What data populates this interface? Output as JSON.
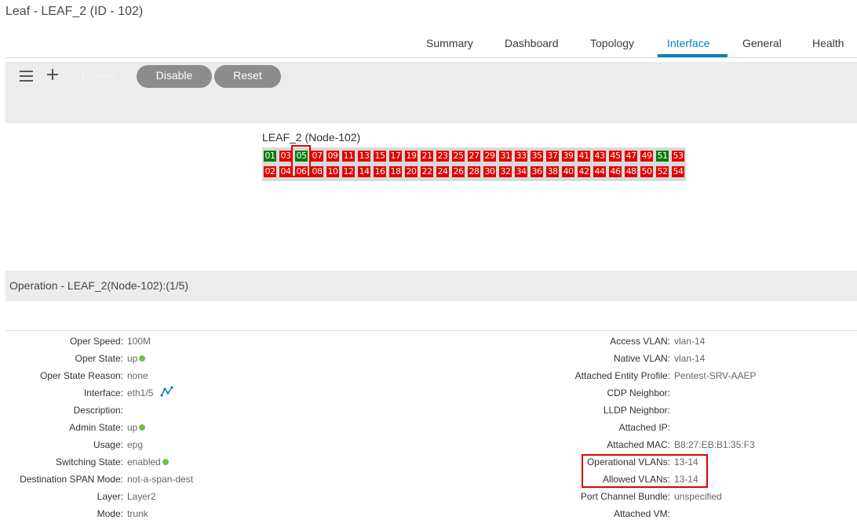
{
  "page_title": "Leaf - LEAF_2 (ID - 102)",
  "tabs": [
    {
      "label": "Summary"
    },
    {
      "label": "Dashboard"
    },
    {
      "label": "Topology"
    },
    {
      "label": "Interface",
      "active": true
    },
    {
      "label": "General"
    },
    {
      "label": "Health"
    }
  ],
  "toolbar": {
    "menu_icon": "hamburger-menu-icon",
    "add_icon": "plus-icon",
    "enable_label": "Enable",
    "disable_label": "Disable",
    "reset_label": "Reset"
  },
  "node": {
    "title": "LEAF_2 (Node-102)",
    "top_row": [
      {
        "id": "01",
        "state": "up"
      },
      {
        "id": "03",
        "state": "down"
      },
      {
        "id": "05",
        "state": "up"
      },
      {
        "id": "07",
        "state": "down"
      },
      {
        "id": "09",
        "state": "down"
      },
      {
        "id": "11",
        "state": "down"
      },
      {
        "id": "13",
        "state": "down"
      },
      {
        "id": "15",
        "state": "down"
      },
      {
        "id": "17",
        "state": "down"
      },
      {
        "id": "19",
        "state": "down"
      },
      {
        "id": "21",
        "state": "down"
      },
      {
        "id": "23",
        "state": "down"
      },
      {
        "id": "25",
        "state": "down"
      },
      {
        "id": "27",
        "state": "down"
      },
      {
        "id": "29",
        "state": "down"
      },
      {
        "id": "31",
        "state": "down"
      },
      {
        "id": "33",
        "state": "down"
      },
      {
        "id": "35",
        "state": "down"
      },
      {
        "id": "37",
        "state": "down"
      },
      {
        "id": "39",
        "state": "down"
      },
      {
        "id": "41",
        "state": "down"
      },
      {
        "id": "43",
        "state": "down"
      },
      {
        "id": "45",
        "state": "down"
      },
      {
        "id": "47",
        "state": "down"
      },
      {
        "id": "49",
        "state": "down"
      },
      {
        "id": "51",
        "state": "up"
      },
      {
        "id": "53",
        "state": "down"
      }
    ],
    "bottom_row": [
      {
        "id": "02",
        "state": "down"
      },
      {
        "id": "04",
        "state": "down"
      },
      {
        "id": "06",
        "state": "down"
      },
      {
        "id": "08",
        "state": "down"
      },
      {
        "id": "10",
        "state": "down"
      },
      {
        "id": "12",
        "state": "down"
      },
      {
        "id": "14",
        "state": "down"
      },
      {
        "id": "16",
        "state": "down"
      },
      {
        "id": "18",
        "state": "down"
      },
      {
        "id": "20",
        "state": "down"
      },
      {
        "id": "22",
        "state": "down"
      },
      {
        "id": "24",
        "state": "down"
      },
      {
        "id": "26",
        "state": "down"
      },
      {
        "id": "28",
        "state": "down"
      },
      {
        "id": "30",
        "state": "down"
      },
      {
        "id": "32",
        "state": "down"
      },
      {
        "id": "34",
        "state": "down"
      },
      {
        "id": "36",
        "state": "down"
      },
      {
        "id": "38",
        "state": "down"
      },
      {
        "id": "40",
        "state": "down"
      },
      {
        "id": "42",
        "state": "down"
      },
      {
        "id": "44",
        "state": "down"
      },
      {
        "id": "46",
        "state": "down"
      },
      {
        "id": "48",
        "state": "down"
      },
      {
        "id": "50",
        "state": "down"
      },
      {
        "id": "52",
        "state": "down"
      },
      {
        "id": "54",
        "state": "down"
      }
    ],
    "selected_port": "05"
  },
  "operation": {
    "title": "Operation - LEAF_2(Node-102):(1/5)",
    "left": [
      {
        "label": "Oper Speed:",
        "value": "100M"
      },
      {
        "label": "Oper State:",
        "value": "up",
        "status": "green"
      },
      {
        "label": "Oper State Reason:",
        "value": "none"
      },
      {
        "label": "Interface:",
        "value": "eth1/5",
        "icon": "topology-graph-icon"
      },
      {
        "label": "Description:",
        "value": ""
      },
      {
        "label": "Admin State:",
        "value": "up",
        "status": "green"
      },
      {
        "label": "Usage:",
        "value": "epg"
      },
      {
        "label": "Switching State:",
        "value": "enabled",
        "status": "green"
      },
      {
        "label": "Destination SPAN Mode:",
        "value": "not-a-span-dest"
      },
      {
        "label": "Layer:",
        "value": "Layer2"
      },
      {
        "label": "Mode:",
        "value": "trunk"
      }
    ],
    "right": [
      {
        "label": "Access VLAN:",
        "value": "vlan-14"
      },
      {
        "label": "Native VLAN:",
        "value": "vlan-14"
      },
      {
        "label": "Attached Entity Profile:",
        "value": "Pentest-SRV-AAEP"
      },
      {
        "label": "CDP Neighbor:",
        "value": ""
      },
      {
        "label": "LLDP Neighbor:",
        "value": ""
      },
      {
        "label": "Attached IP:",
        "value": ""
      },
      {
        "label": "Attached MAC:",
        "value": "B8:27:EB:B1:35:F3"
      },
      {
        "label": "Operational VLANs:",
        "value": "13-14"
      },
      {
        "label": "Allowed VLANs:",
        "value": "13-14"
      },
      {
        "label": "Port Channel Bundle:",
        "value": "unspecified"
      },
      {
        "label": "Attached VM:",
        "value": ""
      }
    ]
  },
  "colors": {
    "accent": "#0a7fc0",
    "port_up": "#0a7a0a",
    "port_down": "#e00000",
    "status_green": "#6cc24a",
    "highlight": "#e00000"
  }
}
